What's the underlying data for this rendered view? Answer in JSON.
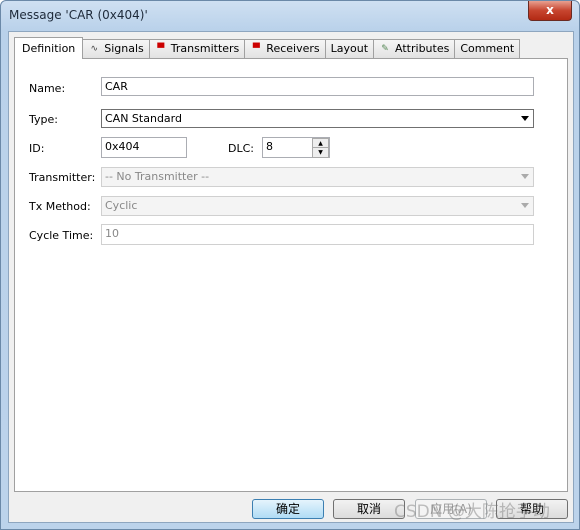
{
  "window": {
    "title": "Message 'CAR (0x404)'",
    "close": "x"
  },
  "tabs": [
    {
      "label": "Definition",
      "icon": ""
    },
    {
      "label": "Signals",
      "icon": "signal-wave-icon"
    },
    {
      "label": "Transmitters",
      "icon": "node-pin-icon"
    },
    {
      "label": "Receivers",
      "icon": "node-pin-icon"
    },
    {
      "label": "Layout",
      "icon": ""
    },
    {
      "label": "Attributes",
      "icon": "pencil-note-icon"
    },
    {
      "label": "Comment",
      "icon": ""
    }
  ],
  "form": {
    "name_label": "Name:",
    "name_value": "CAR",
    "type_label": "Type:",
    "type_value": "CAN Standard",
    "id_label": "ID:",
    "id_value": "0x404",
    "dlc_label": "DLC:",
    "dlc_value": "8",
    "transmitter_label": "Transmitter:",
    "transmitter_value": "-- No Transmitter --",
    "txmethod_label": "Tx Method:",
    "txmethod_value": "Cyclic",
    "cycletime_label": "Cycle Time:",
    "cycletime_value": "10"
  },
  "buttons": {
    "ok": "确定",
    "cancel": "取消",
    "apply": "应用(A)",
    "help": "帮助"
  },
  "watermark": "CSDN @大陈抢手动"
}
